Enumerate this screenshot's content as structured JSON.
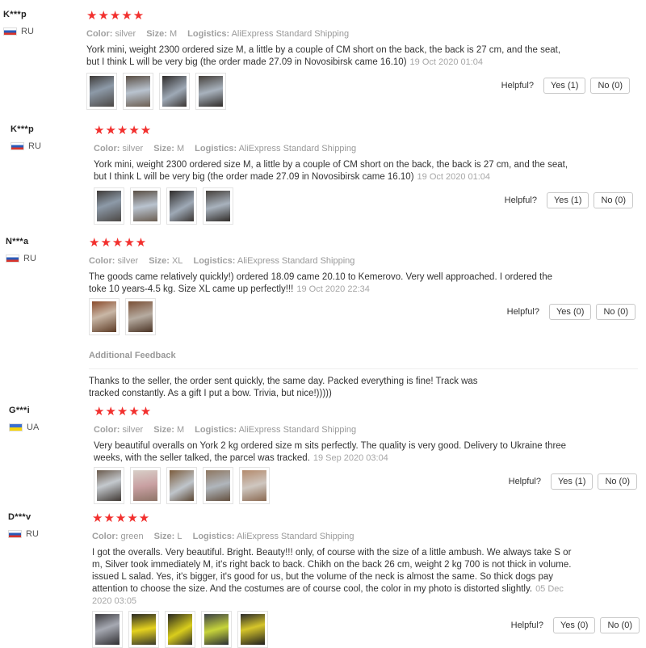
{
  "labels": {
    "color": "Color:",
    "size": "Size:",
    "logistics": "Logistics:",
    "helpful": "Helpful?",
    "additional_feedback": "Additional Feedback"
  },
  "star_color": "#f2302e",
  "reviews": [
    {
      "name": "K***p",
      "country": "RU",
      "flag": "ru-flag",
      "stars": "★★★★★",
      "color": "silver",
      "size": "M",
      "logistics": "AliExpress Standard Shipping",
      "text": "York mini, weight 2300 ordered size M, a little by a couple of CM short on the back, the back is 27 cm, and the seat, but I think L will be very big (the order made 27.09 in Novosibirsk came 16.10)",
      "date": "19 Oct 2020 01:04",
      "yes": "Yes (1)",
      "no": "No (0)"
    },
    {
      "name": "K***p",
      "country": "RU",
      "flag": "ru-flag",
      "stars": "★★★★★",
      "color": "silver",
      "size": "M",
      "logistics": "AliExpress Standard Shipping",
      "text": "York mini, weight 2300 ordered size M, a little by a couple of CM short on the back, the back is 27 cm, and the seat, but I think L will be very big (the order made 27.09 in Novosibirsk came 16.10)",
      "date": "19 Oct 2020 01:04",
      "yes": "Yes (1)",
      "no": "No (0)"
    },
    {
      "name": "N***a",
      "country": "RU",
      "flag": "ru-flag",
      "stars": "★★★★★",
      "color": "silver",
      "size": "XL",
      "logistics": "AliExpress Standard Shipping",
      "text": "The goods came relatively quickly!) ordered 18.09 came 20.10 to Kemerovo. Very well approached. I ordered the toke 10 years-4.5 kg. Size XL came up perfectly!!!",
      "date": "19 Oct 2020 22:34",
      "yes": "Yes (0)",
      "no": "No (0)",
      "additional_feedback": "Thanks to the seller, the order sent quickly, the same day. Packed everything is fine! Track was tracked constantly. As a gift I put a bow. Trivia, but nice!)))))"
    },
    {
      "name": "G***i",
      "country": "UA",
      "flag": "ua-flag",
      "stars": "★★★★★",
      "color": "silver",
      "size": "M",
      "logistics": "AliExpress Standard Shipping",
      "text": "Very beautiful overalls on York 2 kg ordered size m sits perfectly. The quality is very good. Delivery to Ukraine three weeks, with the seller talked, the parcel was tracked.",
      "date": "19 Sep 2020 03:04",
      "yes": "Yes (1)",
      "no": "No (0)"
    },
    {
      "name": "D***v",
      "country": "RU",
      "flag": "ru-flag",
      "stars": "★★★★★",
      "color": "green",
      "size": "L",
      "logistics": "AliExpress Standard Shipping",
      "text": "I got the overalls. Very beautiful. Bright. Beauty!!! only, of course with the size of a little ambush. We always take S or m, Silver took immediately M, it's right back to back. Chikh on the back 26 cm, weight 2 kg 700 is not thick in volume. issued L salad. Yes, it's bigger, it's good for us, but the volume of the neck is almost the same. So thick dogs pay attention to choose the size. And the costumes are of course cool, the color in my photo is distorted slightly.",
      "date": "05 Dec 2020 03:05",
      "yes": "Yes (0)",
      "no": "No (0)"
    }
  ]
}
